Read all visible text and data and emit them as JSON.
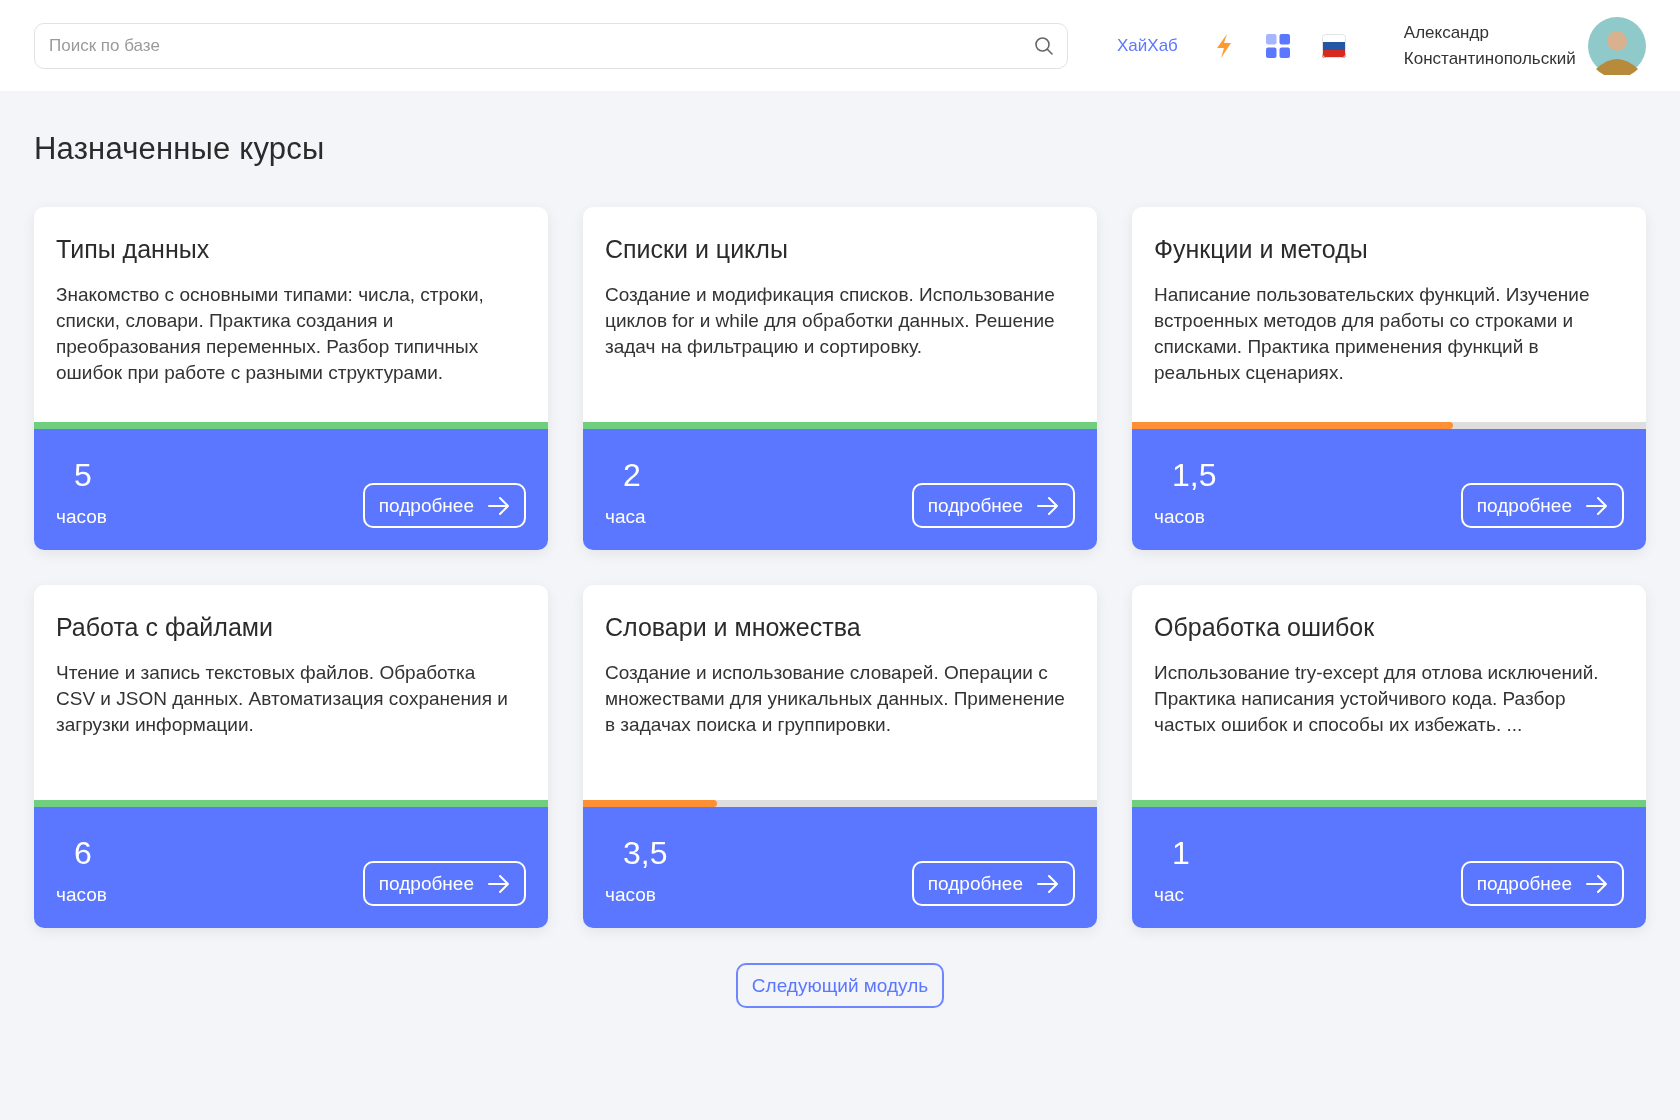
{
  "header": {
    "search": {
      "placeholder": "Поиск по базе"
    },
    "brand_link": "ХайХаб",
    "user": {
      "first_name": "Александр",
      "last_name": "Константинопольский"
    }
  },
  "page_title": "Назначенные курсы",
  "courses": [
    {
      "title": "Типы данных",
      "description": "Знакомство с основными типами: числа, строки, списки, словари. Практика создания и преобразования переменных. Разбор типичных ошибок при работе с разными структурами.",
      "level": 1,
      "color": "#6fcf7f",
      "hours": "5",
      "unit": "часов",
      "button": "подробнее"
    },
    {
      "title": "Списки и циклы",
      "description": "Создание и модификация списков. Использование циклов for и while для обработки данных. Решение задач на фильтрацию и сортировку.",
      "level": 1,
      "color": "#6fcf7f",
      "hours": "2",
      "unit": "часа",
      "button": "подробнее"
    },
    {
      "title": "Функции и методы",
      "description": "Написание пользовательских функций. Изучение встроенных методов для работы со строками и списками. Практика применения функций в реальных сценариях.",
      "level": 0.625,
      "color": "#ff8f33",
      "hours": "1,5",
      "unit": "часов",
      "button": "подробнее"
    },
    {
      "title": "Работа с файлами",
      "description": "Чтение и запись текстовых файлов. Обработка CSV и JSON данных. Автоматизация сохранения и загрузки информации.",
      "level": 1,
      "color": "#6fcf7f",
      "hours": "6",
      "unit": "часов",
      "button": "подробнее"
    },
    {
      "title": "Словари и множества",
      "description": "Создание и использование словарей. Операции с множествами для уникальных данных. Применение в задачах поиска и группировки.",
      "level": 0.26,
      "color": "#ff8f33",
      "hours": "3,5",
      "unit": "часов",
      "button": "подробнее"
    },
    {
      "title": "Обработка ошибок",
      "description": "Использование try-except для отлова исключений. Практика написания устойчивого кода. Разбор частых ошибок и способы их избежать. ...",
      "level": 1,
      "color": "#6fcf7f",
      "hours": "1",
      "unit": "час",
      "button": "подробнее"
    }
  ],
  "next_button": "Следующий модуль"
}
